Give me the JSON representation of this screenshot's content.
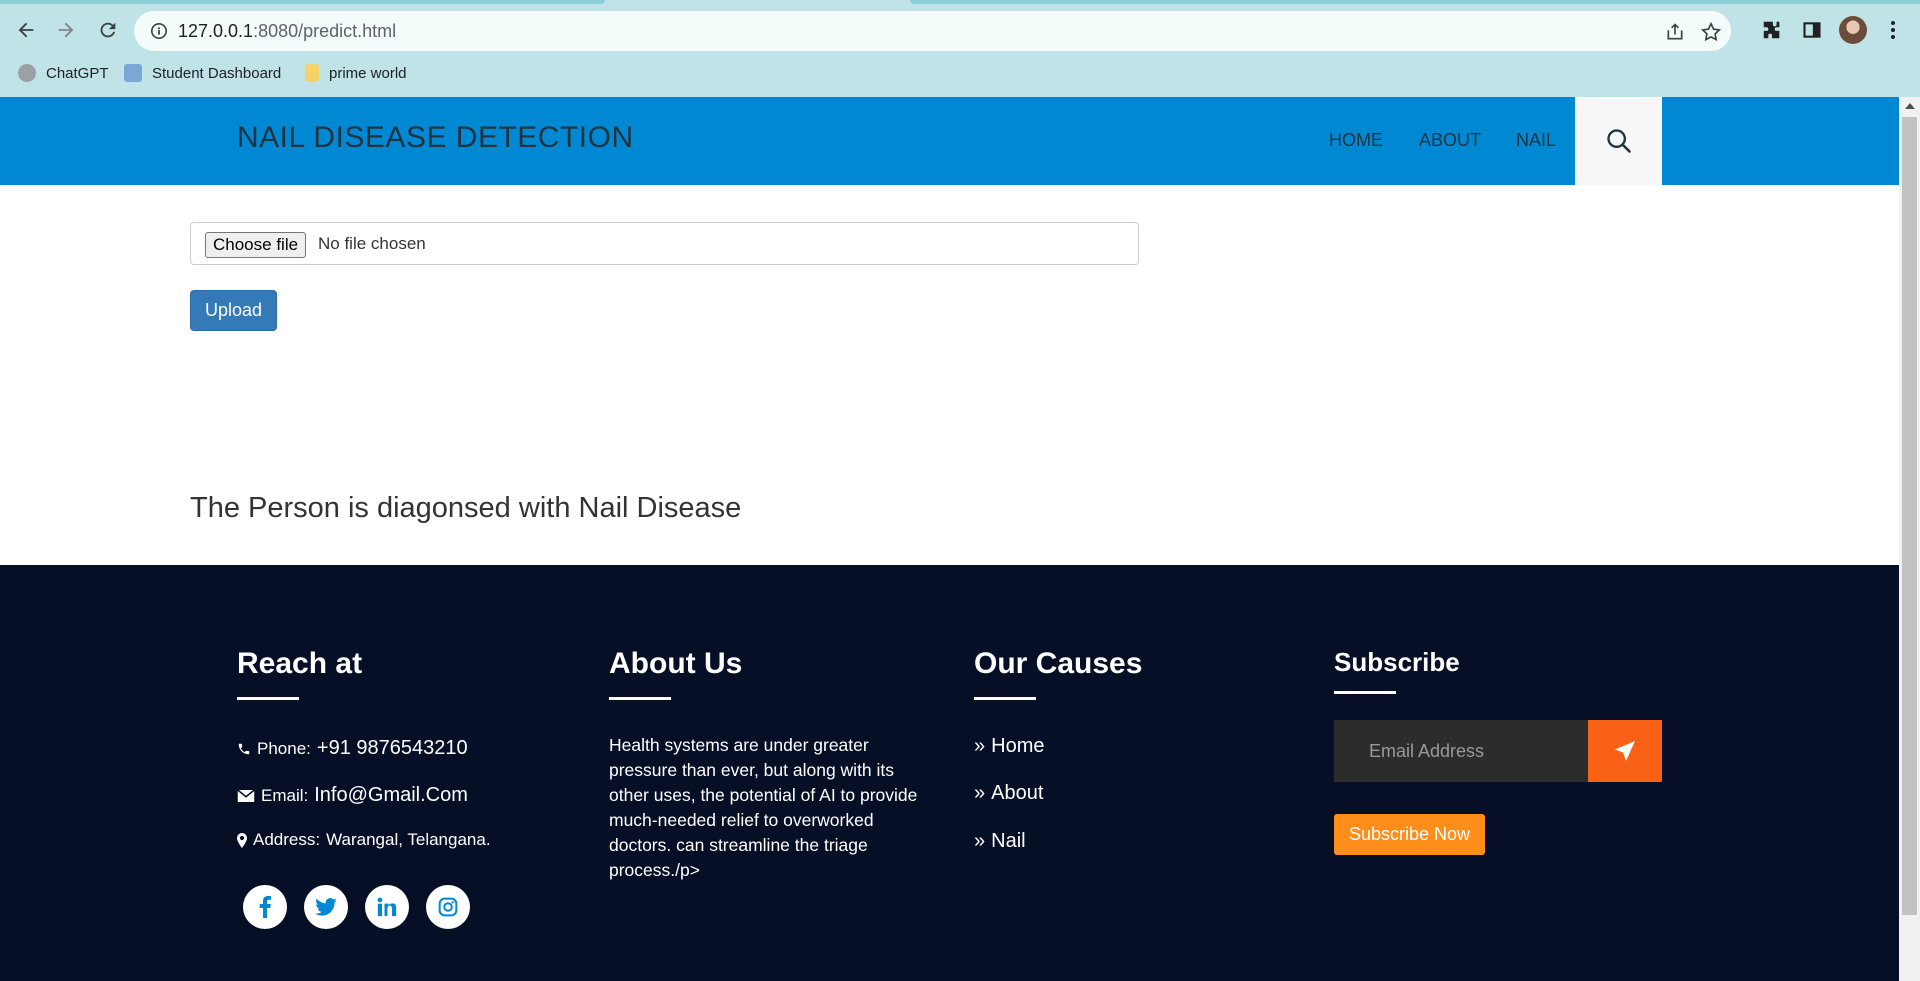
{
  "browser": {
    "url_host": "127.0.0.1",
    "url_path": ":8080/predict.html",
    "bookmarks": [
      {
        "label": "ChatGPT",
        "icon": "chatgpt-icon"
      },
      {
        "label": "Student Dashboard",
        "icon": "dashboard-icon"
      },
      {
        "label": "prime world",
        "icon": "folder-icon"
      }
    ]
  },
  "header": {
    "brand": "NAIL DISEASE DETECTION",
    "menu": [
      "HOME",
      "ABOUT",
      "NAIL"
    ],
    "search_icon": "search-icon"
  },
  "form": {
    "choose_file_label": "Choose file",
    "no_file_text": "No file chosen",
    "upload_label": "Upload"
  },
  "result_text": "The Person is diagonsed with Nail Disease",
  "footer": {
    "reach": {
      "title": "Reach at",
      "phone_label": "Phone:",
      "phone_value": "+91 9876543210",
      "email_label": "Email:",
      "email_value": "Info@Gmail.Com",
      "address_label": "Address:",
      "address_value": "Warangal, Telangana."
    },
    "about": {
      "title": "About Us",
      "text": "Health systems are under greater pressure than ever, but along with its other uses, the potential of AI to provide much-needed relief to overworked doctors. can streamline the triage process./p>"
    },
    "causes": {
      "title": "Our Causes",
      "items": [
        "Home",
        "About",
        "Nail"
      ]
    },
    "subscribe": {
      "title": "Subscribe",
      "email_placeholder": "Email Address",
      "button_label": "Subscribe Now"
    },
    "social": [
      "facebook-icon",
      "twitter-icon",
      "linkedin-icon",
      "instagram-icon"
    ]
  },
  "colors": {
    "header_bg": "#0089d2",
    "footer_bg": "#070f27",
    "upload_btn": "#337ab7",
    "send_btn": "#f96116",
    "subscribe_btn": "#ff8d1a",
    "social_icon": "#0089d2"
  }
}
